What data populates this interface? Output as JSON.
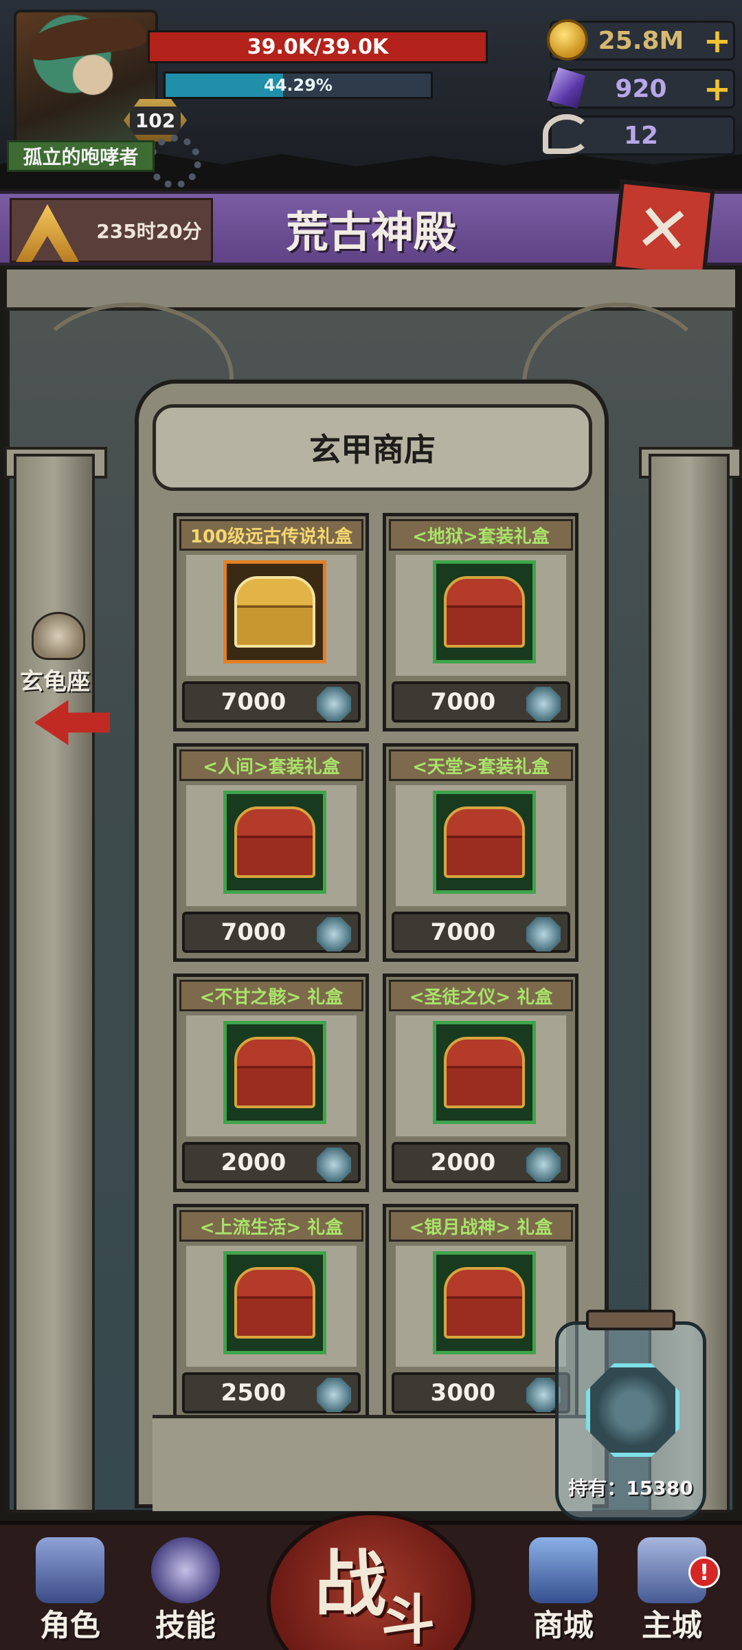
{
  "player": {
    "name": "孤立的咆哮者",
    "level": "102",
    "hp_text": "39.0K/39.0K",
    "hp_fraction": 1.0,
    "exp_text": "44.29%",
    "exp_fraction": 0.4429
  },
  "resources": {
    "gold": "25.8M",
    "gems": "920",
    "horns": "12",
    "plus_label": "+"
  },
  "header": {
    "timer": "235时20分",
    "title": "荒古神殿",
    "close_label": "✕"
  },
  "side_nav": {
    "label": "玄龟座"
  },
  "shop": {
    "title": "玄甲商店",
    "items": [
      {
        "name": "100级远古传说礼盒",
        "price": "7000",
        "rarity": "orange"
      },
      {
        "name": "<地狱>套装礼盒",
        "price": "7000",
        "rarity": "green"
      },
      {
        "name": "<人间>套装礼盒",
        "price": "7000",
        "rarity": "green"
      },
      {
        "name": "<天堂>套装礼盒",
        "price": "7000",
        "rarity": "green"
      },
      {
        "name": "<不甘之骸> 礼盒",
        "price": "2000",
        "rarity": "green"
      },
      {
        "name": "<圣徒之仪> 礼盒",
        "price": "2000",
        "rarity": "green"
      },
      {
        "name": "<上流生活> 礼盒",
        "price": "2500",
        "rarity": "green"
      },
      {
        "name": "<银月战神> 礼盒",
        "price": "3000",
        "rarity": "green"
      }
    ]
  },
  "holdings": {
    "text": "持有：15380"
  },
  "bottom_nav": {
    "character": "角色",
    "skills": "技能",
    "battle_1": "战",
    "battle_2": "斗",
    "shop": "商城",
    "city": "主城",
    "alert": "!"
  },
  "colors": {
    "hp": "#b3221b",
    "exp": "#1f8faa",
    "title_bar": "#6b4e93",
    "rarity_green": "#3fa44b",
    "rarity_orange": "#e27f26",
    "price_text": "#f4f1ea",
    "item_title_green": "#a9e36a",
    "item_title_gold": "#f5d76e"
  }
}
